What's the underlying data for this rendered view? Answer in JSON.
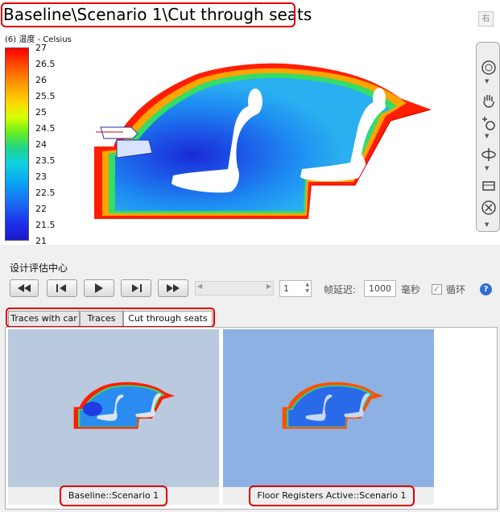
{
  "title": "Baseline\\Scenario 1\\Cut through seats",
  "corner_button": "右",
  "legend": {
    "title": "(6) 温度 - Celsius",
    "ticks": [
      "27",
      "26.5",
      "26",
      "25.5",
      "25",
      "24.5",
      "24",
      "23.5",
      "23",
      "22.5",
      "22",
      "21.5",
      "21"
    ]
  },
  "toolbar_icons": [
    "orbit-icon",
    "hand-pan-icon",
    "zoom-icon",
    "rotate-icon",
    "view-cube-icon",
    "close-circle-icon"
  ],
  "panel": {
    "label": "设计评估中心",
    "playback": {
      "frame_value": "1",
      "delay_label": "帧延迟:",
      "delay_value": "1000",
      "delay_unit": "毫秒",
      "loop_label": "循环",
      "loop_checked": true
    },
    "tabs": [
      {
        "label": "Traces with car",
        "active": false
      },
      {
        "label": "Traces",
        "active": false
      },
      {
        "label": "Cut through seats",
        "active": true
      }
    ],
    "thumbnails": [
      {
        "caption": "Baseline::Scenario 1",
        "bg": "#b9c9de"
      },
      {
        "caption": "Floor Registers Active::Scenario 1",
        "bg": "#8db1e3"
      }
    ]
  },
  "colors": {
    "highlight": "#e00000",
    "accent": "#2d6fd6"
  }
}
